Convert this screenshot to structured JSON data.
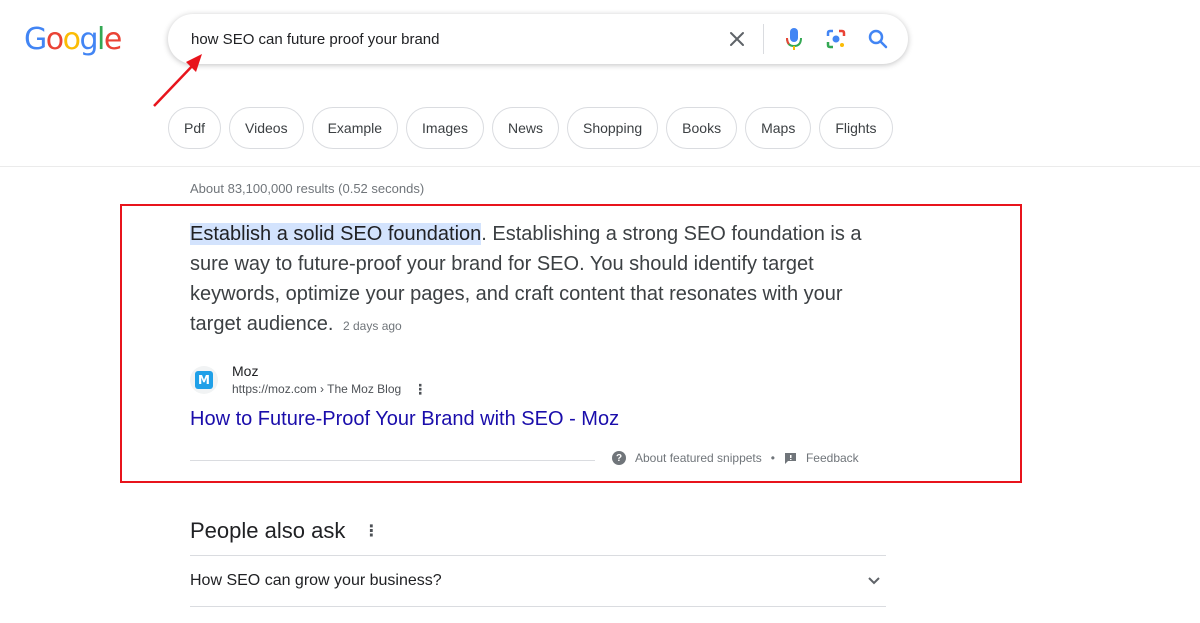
{
  "logo": {
    "letters": [
      "G",
      "o",
      "o",
      "g",
      "l",
      "e"
    ],
    "colors": [
      "#4285F4",
      "#EA4335",
      "#FBBC05",
      "#4285F4",
      "#34A853",
      "#EA4335"
    ]
  },
  "search": {
    "query": "how SEO can future proof your brand",
    "icons": [
      "close-icon",
      "microphone-icon",
      "lens-icon",
      "search-icon"
    ]
  },
  "annotation": {
    "arrow_color": "#e8141c",
    "box_color": "#e8141c"
  },
  "chips": [
    "Pdf",
    "Videos",
    "Example",
    "Images",
    "News",
    "Shopping",
    "Books",
    "Maps",
    "Flights"
  ],
  "stats": "About 83,100,000 results (0.52 seconds)",
  "snippet": {
    "highlight": "Establish a solid SEO foundation",
    "rest": ". Establishing a strong SEO foundation is a sure way to future-proof your brand for SEO. You should identify target keywords, optimize your pages, and craft content that resonates with your target audience.",
    "date": "2 days ago"
  },
  "source": {
    "favicon_letter": "M",
    "name": "Moz",
    "url": "https://moz.com › The Moz Blog",
    "kebab": "⋮",
    "title": "How to Future-Proof Your Brand with SEO - Moz"
  },
  "snippet_footer": {
    "about": "About featured snippets",
    "dot": "•",
    "feedback": "Feedback"
  },
  "paa": {
    "title": "People also ask",
    "kebab": "⋮",
    "items": [
      "How SEO can grow your business?"
    ]
  }
}
